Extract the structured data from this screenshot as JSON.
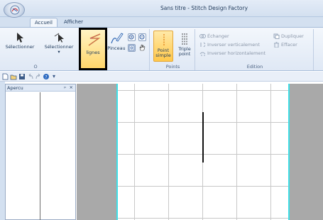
{
  "window": {
    "title": "Sans titre - Stitch Design Factory"
  },
  "tabs": [
    {
      "label": "Accueil",
      "active": true
    },
    {
      "label": "Afficher",
      "active": false
    }
  ],
  "ribbon": {
    "select_group": {
      "label_partial": "O",
      "buttons": [
        {
          "label": "Sélectionner",
          "icon": "arrow-cursor-icon"
        },
        {
          "label": "Sélectionner",
          "icon": "lasso-select-icon",
          "dropdown": "▾"
        },
        {
          "label": "lignes",
          "icon": "zigzag-lines-icon",
          "selected": true
        },
        {
          "label": "Pinceau",
          "icon": "brush-icon"
        }
      ]
    },
    "points_group": {
      "label": "Points",
      "buttons": [
        {
          "label_line1": "Point",
          "label_line2": "simple",
          "icon": "single-point-icon",
          "active": true
        },
        {
          "label_line1": "Triple",
          "label_line2": "point",
          "icon": "triple-point-icon"
        }
      ]
    },
    "edition_group": {
      "label": "Edition",
      "items": [
        {
          "label": "Échanger",
          "icon": "swap-icon"
        },
        {
          "label": "Inverser verticalement",
          "icon": "flip-vertical-icon"
        },
        {
          "label": "Inverser horizontalement",
          "icon": "flip-horizontal-icon"
        },
        {
          "label": "Dupliquer",
          "icon": "duplicate-icon"
        },
        {
          "label": "Effacer",
          "icon": "erase-icon"
        }
      ]
    }
  },
  "quick_access": {
    "icons": [
      "new-file-icon",
      "open-file-icon",
      "save-icon",
      "undo-icon",
      "redo-icon",
      "help-icon"
    ],
    "more": "▾"
  },
  "panel": {
    "title": "Apercu",
    "pin": "ᵖ",
    "close": "×"
  }
}
